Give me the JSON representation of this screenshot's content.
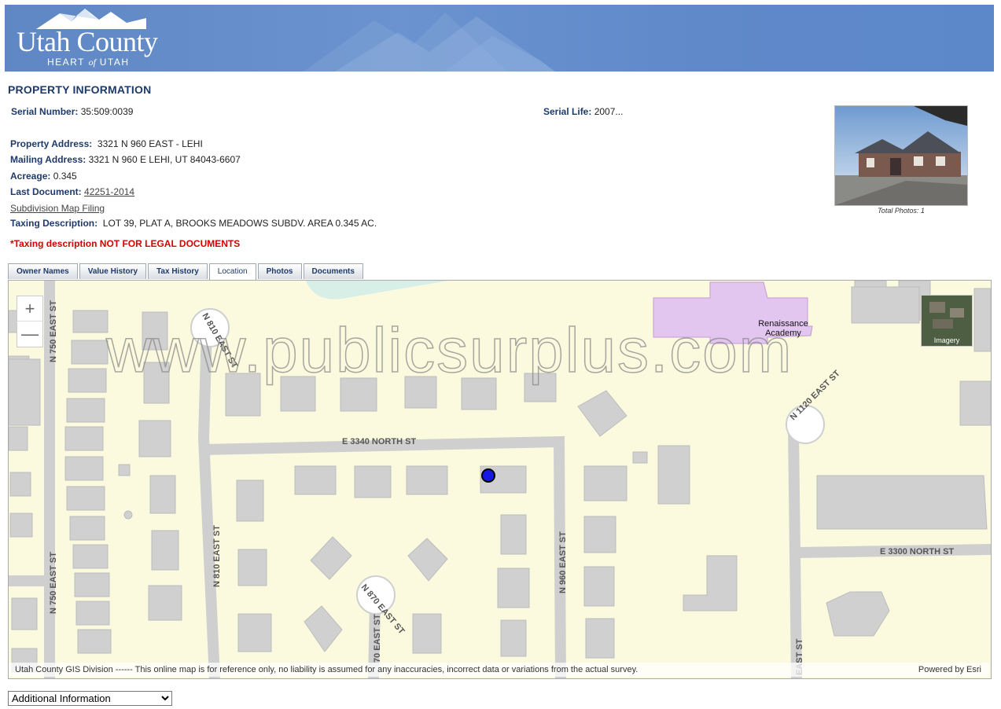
{
  "header": {
    "logo_title": "Utah County",
    "logo_sub_prefix": "HEART ",
    "logo_sub_of": "of",
    "logo_sub_suffix": " UTAH"
  },
  "page_title": "PROPERTY INFORMATION",
  "fields": {
    "serial_number_label": "Serial Number:",
    "serial_number_value": "35:509:0039",
    "serial_life_label": "Serial Life:",
    "serial_life_value": "2007...",
    "property_address_label": "Property Address:",
    "property_address_value": "3321 N 960 EAST - LEHI",
    "mailing_address_label": "Mailing Address:",
    "mailing_address_value": "3321 N 960 E LEHI, UT 84043-6607",
    "acreage_label": "Acreage:",
    "acreage_value": "0.345",
    "last_document_label": "Last Document:",
    "last_document_value": "42251-2014",
    "subdivision_link": "Subdivision Map Filing",
    "taxing_description_label": "Taxing Description:",
    "taxing_description_value": "LOT 39, PLAT A, BROOKS MEADOWS SUBDV. AREA 0.345 AC.",
    "warning": "*Taxing description NOT FOR LEGAL DOCUMENTS"
  },
  "photo": {
    "caption": "Total Photos: 1"
  },
  "tabs": [
    {
      "label": "Owner Names"
    },
    {
      "label": "Value History"
    },
    {
      "label": "Tax History"
    },
    {
      "label": "Location",
      "active": true
    },
    {
      "label": "Photos"
    },
    {
      "label": "Documents"
    }
  ],
  "map": {
    "zoom_in": "+",
    "zoom_out": "—",
    "imagery_label": "Imagery",
    "school_label_1": "Renaissance",
    "school_label_2": "Academy",
    "watermark": "www.publicsurplus.com",
    "streets": {
      "n750": "N 750 EAST ST",
      "n750b": "N 750 EAST ST",
      "n810ct": "N 810 EAST ST",
      "n810": "N 810 EAST ST",
      "e3340": "E 3340 NORTH ST",
      "n960": "N 960 EAST ST",
      "n870": "N 870 EAST ST",
      "n870b": "70 EAST ST",
      "n1120": "N 1120 EAST ST",
      "e3300": "E 3300 NORTH ST",
      "eastst": "EAST ST"
    },
    "attribution_left": "Utah County GIS Division ------ This online map is for reference only, no liability is assumed for any inaccuracies, incorrect data or variations from the actual survey.",
    "attribution_right": "Powered by Esri"
  },
  "additional_select": {
    "selected": "Additional Information"
  },
  "colors": {
    "banner": "#5f87c4",
    "map_bg": "#fbfadf",
    "road": "#cfcfcf",
    "building": "#d0d0d0",
    "school": "#e3c6f0",
    "marker": "#1616e6",
    "warning": "#d60000"
  }
}
